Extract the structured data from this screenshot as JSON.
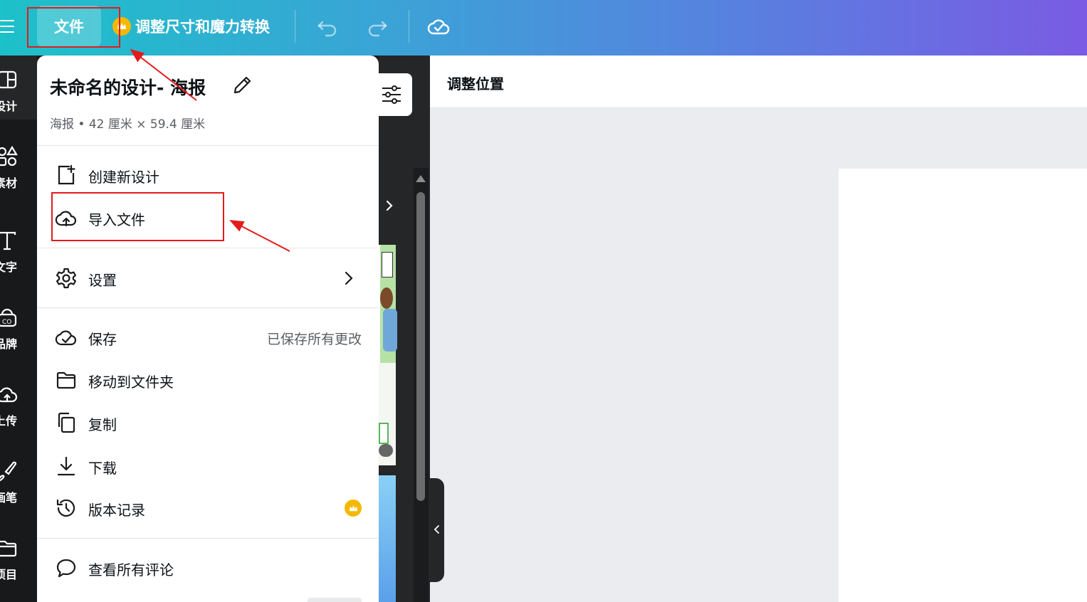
{
  "toolbar": {
    "file_label": "文件",
    "resize_label": "调整尺寸和魔力转换"
  },
  "rail": {
    "items": [
      {
        "label": "设计",
        "icon": "layout-icon"
      },
      {
        "label": "素材",
        "icon": "shapes-icon"
      },
      {
        "label": "文字",
        "icon": "text-icon"
      },
      {
        "label": "品牌",
        "icon": "brand-icon"
      },
      {
        "label": "上传",
        "icon": "cloud-upload-icon"
      },
      {
        "label": "画笔",
        "icon": "draw-icon"
      },
      {
        "label": "项目",
        "icon": "folder-icon"
      }
    ]
  },
  "menu": {
    "title": "未命名的设计- 海报",
    "subtitle": "海报 • 42 厘米 × 59.4 厘米",
    "items": {
      "create": "创建新设计",
      "import": "导入文件",
      "settings": "设置",
      "save": "保存",
      "save_status": "已保存所有更改",
      "move": "移动到文件夹",
      "copy": "复制",
      "download": "下载",
      "history": "版本记录",
      "comments": "查看所有评论"
    }
  },
  "editor": {
    "title": "调整位置"
  },
  "colors": {
    "accent_start": "#1cc1c9",
    "accent_end": "#7a5be3",
    "annotation": "#e31b1b",
    "pro_crown": "#f5b800"
  }
}
